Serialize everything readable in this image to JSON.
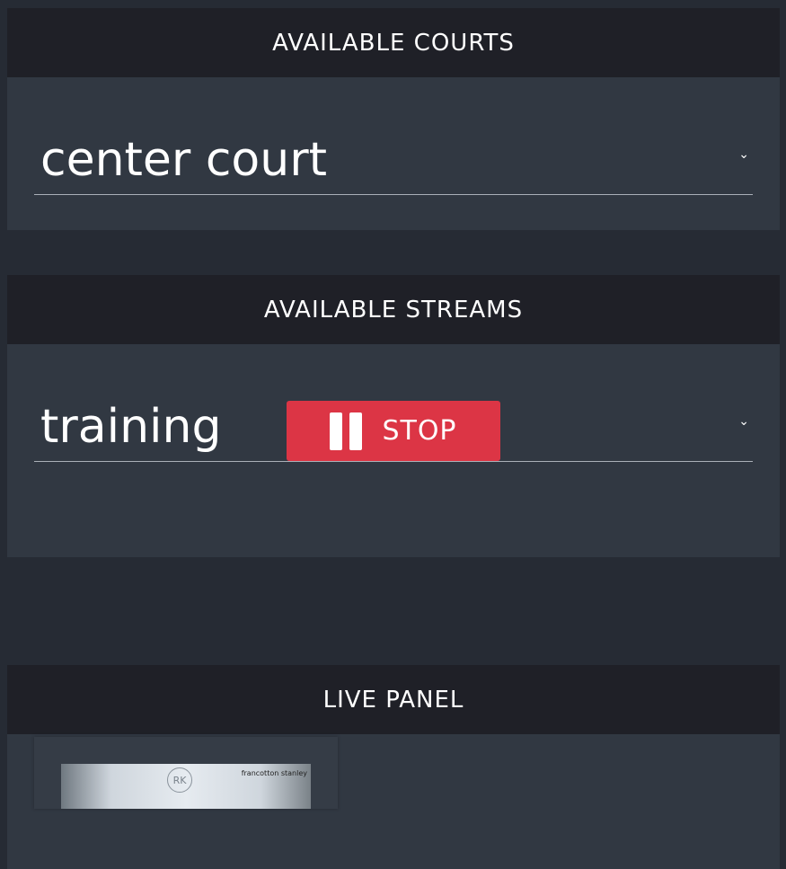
{
  "courts": {
    "header": "AVAILABLE COURTS",
    "selected": "center court"
  },
  "streams": {
    "header": "AVAILABLE STREAMS",
    "selected": "training",
    "stop_label": "STOP"
  },
  "live": {
    "header": "LIVE PANEL",
    "thumbnail": {
      "logo_text": "RK",
      "brand_text": "francotton stanley"
    }
  },
  "icons": {
    "dropdown": "chevron-down-icon",
    "stop": "pause-icon"
  },
  "colors": {
    "background": "#262b34",
    "panel": "#313842",
    "header": "#1f2027",
    "stop_button": "#dc3545"
  }
}
